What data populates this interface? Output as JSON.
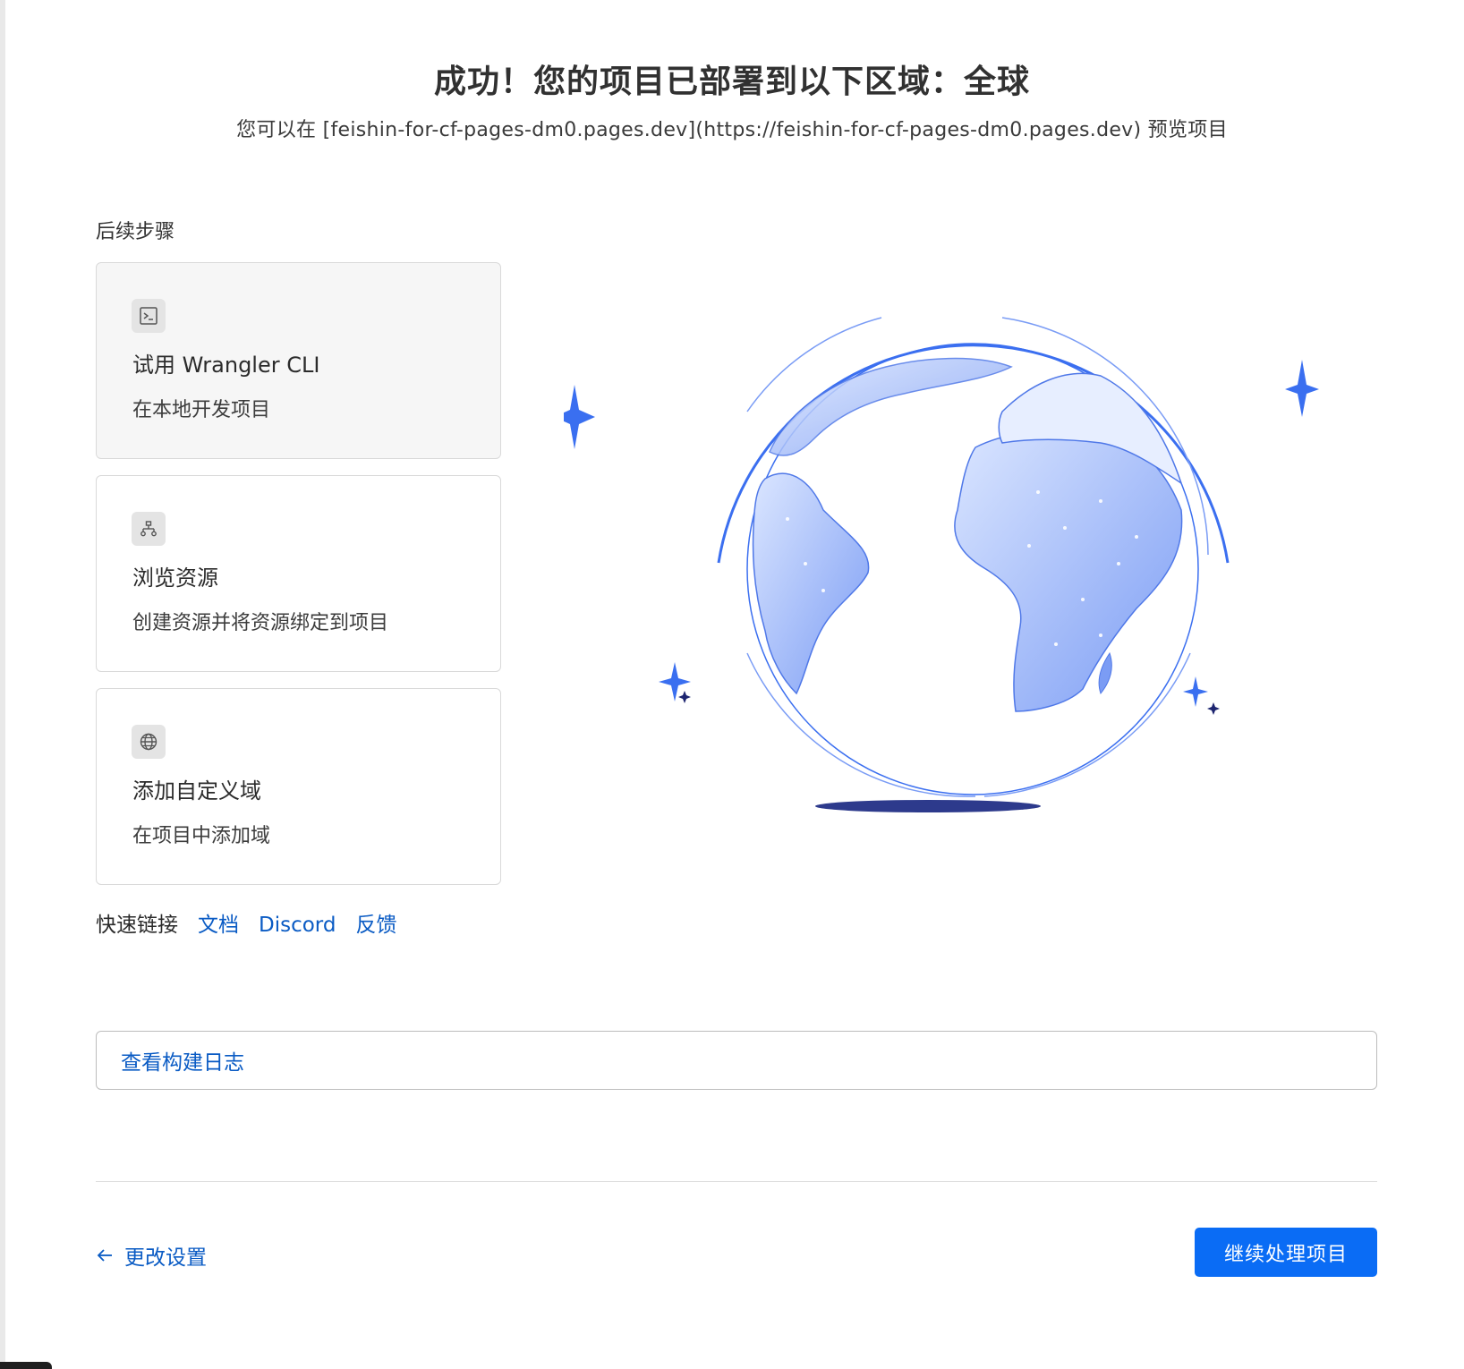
{
  "header": {
    "title": "成功！您的项目已部署到以下区域：全球",
    "subtitle": "您可以在 [feishin-for-cf-pages-dm0.pages.dev](https://feishin-for-cf-pages-dm0.pages.dev) 预览项目"
  },
  "next_steps": {
    "heading": "后续步骤",
    "cards": [
      {
        "icon": "terminal-icon",
        "title": "试用 Wrangler CLI",
        "description": "在本地开发项目"
      },
      {
        "icon": "sitemap-icon",
        "title": "浏览资源",
        "description": "创建资源并将资源绑定到项目"
      },
      {
        "icon": "globe-icon",
        "title": "添加自定义域",
        "description": "在项目中添加域"
      }
    ]
  },
  "quick_links": {
    "label": "快速链接",
    "links": [
      "文档",
      "Discord",
      "反馈"
    ]
  },
  "build_log": {
    "label": "查看构建日志"
  },
  "footer": {
    "back_label": "更改设置",
    "continue_label": "继续处理项目"
  },
  "colors": {
    "accent": "#0a6cf5",
    "link": "#0a5bc4",
    "globe_light": "#c9d9ff",
    "globe_dark": "#7d9ef5",
    "sparkle": "#3a6ff0",
    "shadow": "#2d3a8c"
  }
}
